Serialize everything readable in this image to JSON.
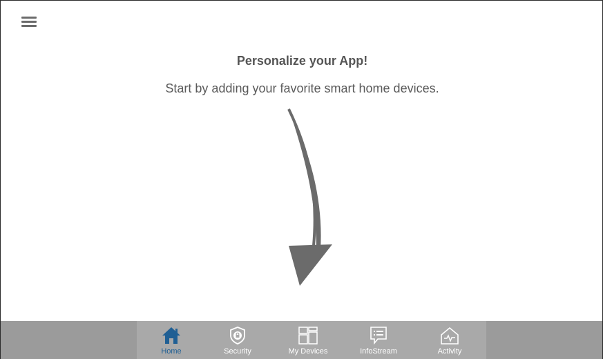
{
  "header": {
    "menu_icon": "hamburger-menu-icon"
  },
  "main": {
    "title": "Personalize your App!",
    "subtitle": "Start by adding your favorite smart home devices.",
    "arrow_icon": "curved-arrow-down-icon"
  },
  "tabbar": {
    "tabs": [
      {
        "label": "Home",
        "icon": "home-icon",
        "active": true
      },
      {
        "label": "Security",
        "icon": "shield-lock-icon",
        "active": false
      },
      {
        "label": "My Devices",
        "icon": "devices-grid-icon",
        "active": false
      },
      {
        "label": "InfoStream",
        "icon": "message-list-icon",
        "active": false
      },
      {
        "label": "Activity",
        "icon": "activity-house-icon",
        "active": false
      }
    ]
  },
  "colors": {
    "active_tab": "#1f5f94",
    "tabbar_bg": "#9b9b9b",
    "tabbar_inner_bg": "#a9a9a9",
    "text_primary": "#555555"
  }
}
